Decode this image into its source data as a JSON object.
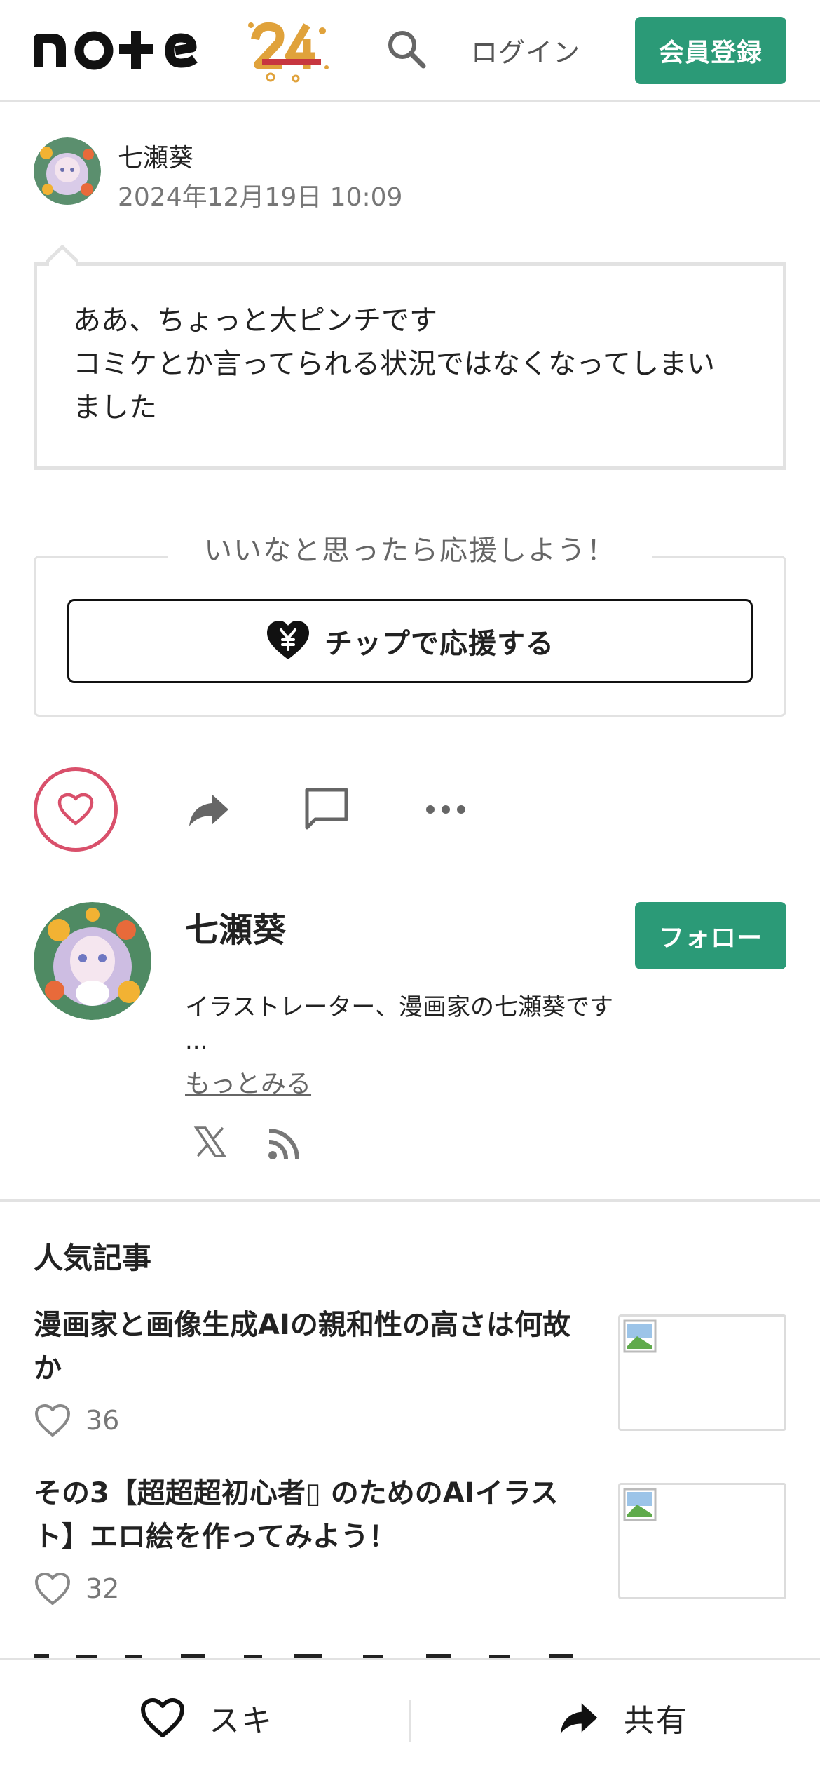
{
  "header": {
    "logo_text": "note",
    "logo_badge": "24",
    "icons": {
      "search": "search-icon"
    },
    "login_label": "ログイン",
    "signup_label": "会員登録",
    "brand_color": "#2b9a77"
  },
  "post": {
    "author": "七瀬葵",
    "date": "2024年12月19日 10:09",
    "body_lines": [
      "ああ、ちょっと大ピンチです",
      "コミケとか言ってられる状況ではなくなってしまい",
      "ました"
    ]
  },
  "support": {
    "legend": "いいなと思ったら応援しよう！",
    "tip_button_label": "チップで応援する",
    "icons": {
      "tip": "heart-yen-icon"
    }
  },
  "actions": {
    "icons": [
      "heart-icon",
      "share-icon",
      "comment-icon",
      "more-icon"
    ],
    "like_color": "#d9506b"
  },
  "creator": {
    "name": "七瀬葵",
    "follow_label": "フォロー",
    "bio": "イラストレーター、漫画家の七瀬葵です",
    "bio_ellipsis": "...",
    "more_label": "もっとみる",
    "icons": [
      "x-icon",
      "rss-icon"
    ]
  },
  "popular": {
    "heading": "人気記事",
    "articles": [
      {
        "title": "漫画家と画像生成AIの親和性の高さは何故か",
        "likes": "36"
      },
      {
        "title": "その3【超超超初心者▯ のためのAIイラスト】エロ絵を作ってみよう！",
        "likes": "32"
      }
    ]
  },
  "bottom_bar": {
    "like_label": "スキ",
    "share_label": "共有",
    "icons": [
      "heart-icon",
      "share-icon"
    ]
  }
}
